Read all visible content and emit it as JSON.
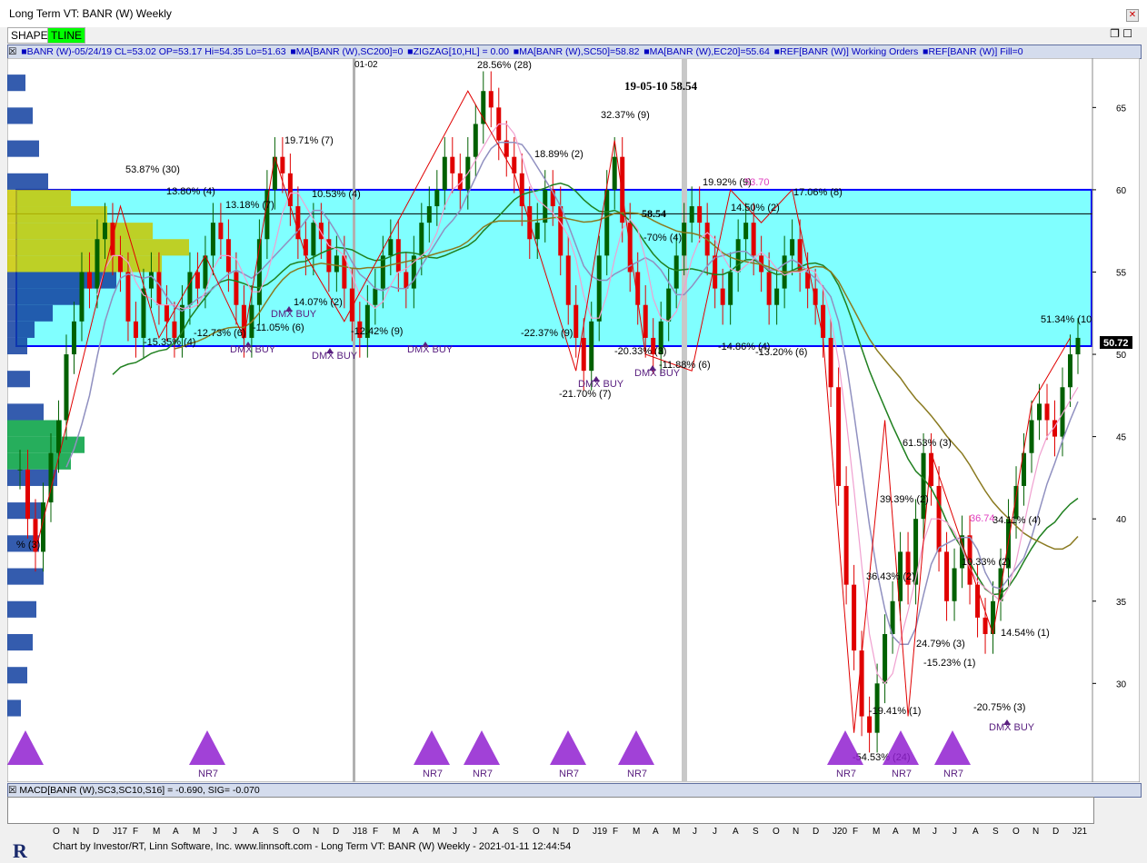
{
  "window": {
    "title": "Long Term VT: BANR (W) Weekly"
  },
  "toolbar": {
    "shape": "SHAPE",
    "tline": "TLINE"
  },
  "legend": {
    "items": [
      {
        "text": "BANR (W)-05/24/19 CL=53.02 OP=53.17 Hi=54.35 Lo=51.63",
        "color": "#0000c0"
      },
      {
        "text": "MA[BANR (W),SC200]=0",
        "color": "#0000c0"
      },
      {
        "text": "ZIGZAG[10,HL] = 0.00",
        "color": "#0000c0"
      },
      {
        "text": "MA[BANR (W),SC50]=58.82",
        "color": "#0000c0"
      },
      {
        "text": "MA[BANR (W),EC20]=55.64",
        "color": "#0000c0"
      },
      {
        "text": "REF[BANR (W)] Working Orders",
        "color": "#0000c0"
      },
      {
        "text": "REF[BANR (W)] Fill=0",
        "color": "#0000c0"
      }
    ]
  },
  "macd": {
    "label": "MACD[BANR (W),SC3,SC10,S16] = -0.690, SIG= -0.070"
  },
  "footer": {
    "text": "Chart by Investor/RT, Linn Software, Inc. www.linnsoft.com - Long Term VT: BANR (W) Weekly - 2021-01-11 12:44:54"
  },
  "chart_data": {
    "type": "candlestick",
    "title": "19-05-10  58.54",
    "last_price_tag": "50.72",
    "zone_bottom": 50.5,
    "zone_top": 60.0,
    "ylim": [
      24,
      68
    ],
    "yticks": [
      30,
      35,
      40,
      45,
      50,
      55,
      60,
      65
    ],
    "xticks": [
      "O",
      "N",
      "D",
      "J17",
      "F",
      "M",
      "A",
      "M",
      "J",
      "J",
      "A",
      "S",
      "O",
      "N",
      "D",
      "J18",
      "F",
      "M",
      "A",
      "M",
      "J",
      "J",
      "A",
      "S",
      "O",
      "N",
      "D",
      "J19",
      "F",
      "M",
      "A",
      "M",
      "J",
      "J",
      "A",
      "S",
      "O",
      "N",
      "D",
      "J20",
      "F",
      "M",
      "A",
      "M",
      "J",
      "J",
      "A",
      "S",
      "O",
      "N",
      "D",
      "J21"
    ],
    "marker_label": "01-02",
    "price_label": "58.54",
    "colors": {
      "zone": "#80ffff",
      "zone_border": "#0000ff",
      "up": "#006000",
      "down": "#e00000",
      "ma50": "#208020",
      "ma20": "#9090c0",
      "ma200": "#8a7a20",
      "ma_pink": "#f0a0d0",
      "ma_purple": "#7030d0",
      "zigzag": "#e00000",
      "triangle": "#9020d0"
    },
    "closes": [
      43,
      40,
      38,
      41,
      44,
      46,
      50,
      52,
      55,
      54,
      57,
      58,
      56,
      55,
      52,
      51,
      54,
      55,
      53,
      52,
      51,
      53,
      55,
      54,
      56,
      58,
      57,
      55,
      53,
      51,
      53,
      57,
      60,
      62,
      61,
      59,
      57,
      56,
      58,
      57,
      55,
      56,
      54,
      52,
      51,
      53,
      54,
      56,
      57,
      55,
      54,
      56,
      58,
      59,
      60,
      62,
      61,
      60,
      62,
      64,
      66,
      65,
      63,
      62,
      61,
      59,
      57,
      58,
      60,
      59,
      56,
      53,
      51,
      49,
      52,
      56,
      60,
      62,
      58,
      55,
      53,
      51,
      50,
      52,
      54,
      56,
      58,
      59,
      58,
      56,
      54,
      53,
      55,
      57,
      58,
      56,
      55,
      53,
      54,
      56,
      57,
      55,
      54,
      53,
      51,
      48,
      42,
      36,
      32,
      28,
      27,
      30,
      33,
      35,
      38,
      36,
      40,
      44,
      42,
      38,
      35,
      37,
      39,
      36,
      34,
      33,
      35,
      37,
      40,
      42,
      44,
      46,
      47,
      46,
      45,
      48,
      50,
      51
    ],
    "swing_labels": [
      "53.87% (30)",
      "13.80% (4)",
      "-15.35% (4)",
      "-12.73% (6)",
      "13.18% (7)",
      "-11.05% (6)",
      "19.71% (7)",
      "10.53% (4)",
      "14.07% (2)",
      "-12.42% (9)",
      "28.56% (28)",
      "18.89% (2)",
      "-22.37% (9)",
      "32.37% (9)",
      "-21.70% (7)",
      "-20.33% (3)",
      "-11.88% (6)",
      "19.92% (9)",
      "14.50% (2)",
      "17.06% (8)",
      "-14.86% (4)",
      "-13.20% (6)",
      "61.53% (3)",
      "39.39% (2)",
      "36.43% (2)",
      "-19.41% (1)",
      "-54.53% (24)",
      "24.79% (3)",
      "-15.23% (1)",
      "10.33% (2)",
      "34.11% (4)",
      "14.54% (1)",
      "-20.75% (3)",
      "51.34% (10)",
      "% (3)",
      "-70% (4)"
    ],
    "signals": [
      "DMX BUY",
      "DMX BUY",
      "DMX BUY",
      "DMX BUY",
      "DMX BUY",
      "DMX BUY",
      "DMX BUY"
    ],
    "nr7": [
      "NR7",
      "NR7",
      "NR7",
      "NR7",
      "NR7",
      "NR7",
      "NR7",
      "NR7"
    ],
    "pink_labels": [
      "53.70",
      "36.74"
    ]
  }
}
